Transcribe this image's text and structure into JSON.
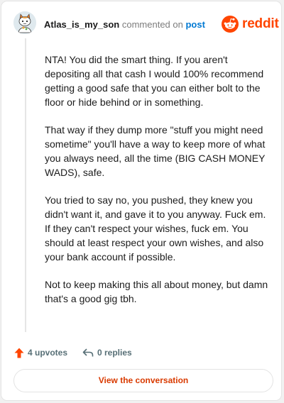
{
  "header": {
    "username": "Atlas_is_my_son",
    "connector": "commented on",
    "post_link": "post",
    "brand": "reddit"
  },
  "comment": {
    "paragraphs": [
      "NTA! You did the smart thing. If you aren't depositing all that cash I would 100% recommend getting a good safe that you can either bolt to the floor or hide behind or in something.",
      "That way if they dump more \"stuff you might need sometime\" you'll have a way to keep more of what you always need, all the time (BIG CASH MONEY WADS), safe.",
      "You tried to say no, you pushed, they knew you didn't want it, and gave it to you anyway. Fuck em. If they can't respect your wishes, fuck em. You should at least respect your own wishes, and also your bank account if possible.",
      "Not to keep making this all about money, but damn that's a good gig tbh."
    ]
  },
  "actions": {
    "upvotes": "4 upvotes",
    "replies": "0 replies"
  },
  "cta": {
    "label": "View the conversation"
  },
  "colors": {
    "brand": "#ff4500",
    "link": "#0079d3",
    "upvote": "#ff4500",
    "cta_text": "#d93a00"
  },
  "icons": {
    "avatar": "snoo-avatar",
    "brand": "reddit-snoo-icon",
    "upvote": "upvote-arrow-icon",
    "reply": "reply-arrow-icon"
  }
}
